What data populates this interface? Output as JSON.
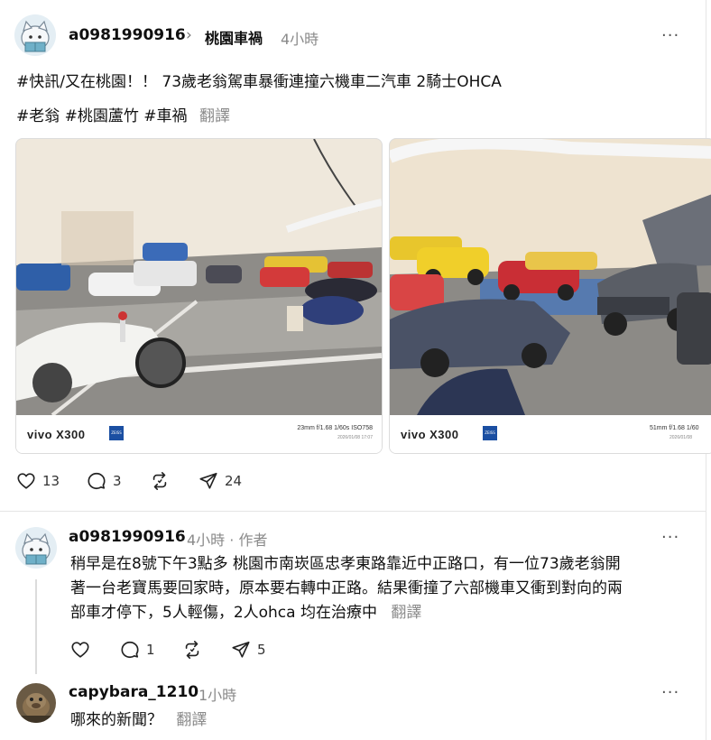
{
  "post": {
    "username": "a0981990916",
    "separator": "›",
    "topic": "桃園車禍",
    "time": "4小時",
    "more": "···",
    "text": "#快訊/又在桃園！！ 73歲老翁駕車暴衝連撞六機車二汽車 2騎士OHCA",
    "tags": "#老翁 #桃園蘆竹 #車禍",
    "translate": "翻譯",
    "photos": [
      {
        "brand": "vivo X300",
        "zeiss": "ZEISS",
        "specs": "23mm  f/1.68  1/60s  ISO758",
        "date": "2026/01/08 17:07"
      },
      {
        "brand": "vivo X300",
        "zeiss": "ZEISS",
        "specs": "51mm  f/1.68  1/60",
        "date": "2026/01/08"
      }
    ],
    "actions": {
      "likes": "13",
      "comments": "3",
      "reposts": "",
      "shares": "24"
    }
  },
  "replies": [
    {
      "username": "a0981990916",
      "time": "4小時",
      "dot": "·",
      "role": "作者",
      "more": "···",
      "lines": [
        "稍早是在8號下午3點多 桃園市南崁區忠孝東路靠近中正路口，有一位73歲老翁開",
        "著一台老寶馬要回家時，原本要右轉中正路。結果衝撞了六部機車又衝到對向的兩",
        "部車才停下，5人輕傷，2人ohca 均在治療中"
      ],
      "translate": "翻譯",
      "actions": {
        "likes": "",
        "comments": "1",
        "reposts": "",
        "shares": "5"
      }
    },
    {
      "username": "capybara_1210",
      "time": "1小時",
      "more": "···",
      "text": "哪來的新聞？",
      "translate": "翻譯"
    }
  ]
}
